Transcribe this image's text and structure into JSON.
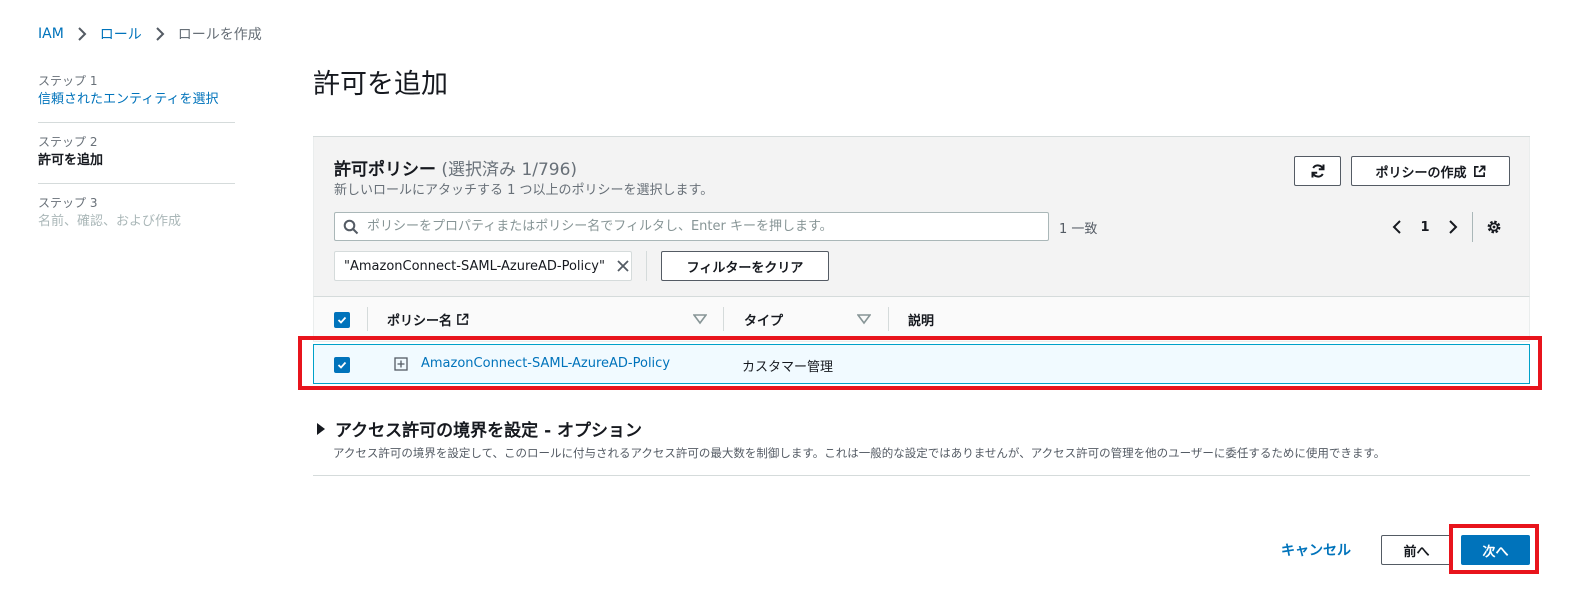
{
  "breadcrumb": {
    "items": [
      "IAM",
      "ロール",
      "ロールを作成"
    ]
  },
  "steps": [
    {
      "num": "ステップ 1",
      "name": "信頼されたエンティティを選択",
      "state": "link"
    },
    {
      "num": "ステップ 2",
      "name": "許可を追加",
      "state": "current"
    },
    {
      "num": "ステップ 3",
      "name": "名前、確認、および作成",
      "state": "disabled"
    }
  ],
  "page": {
    "title": "許可を追加"
  },
  "policies": {
    "title": "許可ポリシー",
    "count": "(選択済み 1/796)",
    "description": "新しいロールにアタッチする 1 つ以上のポリシーを選択します。",
    "create_button": "ポリシーの作成",
    "refresh_icon": "refresh-icon",
    "search_placeholder": "ポリシーをプロパティまたはポリシー名でフィルタし、Enter キーを押します。",
    "match_count": "1 一致",
    "page_number": "1",
    "filter_token": "\"AmazonConnect-SAML-AzureAD-Policy\"",
    "clear_filter": "フィルターをクリア",
    "columns": {
      "name": "ポリシー名",
      "type": "タイプ",
      "description": "説明"
    },
    "rows": [
      {
        "name": "AmazonConnect-SAML-AzureAD-Policy",
        "type": "カスタマー管理",
        "selected": true
      }
    ]
  },
  "boundary": {
    "title": "アクセス許可の境界を設定 - オプション",
    "description": "アクセス許可の境界を設定して、このロールに付与されるアクセス許可の最大数を制御します。これは一般的な設定ではありませんが、アクセス許可の管理を他のユーザーに委任するために使用できます。"
  },
  "footer": {
    "cancel": "キャンセル",
    "prev": "前へ",
    "next": "次へ"
  },
  "colors": {
    "link": "#0073bb",
    "primary_button": "#0073bb",
    "highlight": "#e8141c",
    "selected_row_bg": "#f1faff",
    "selected_row_border": "#00a1c9"
  }
}
